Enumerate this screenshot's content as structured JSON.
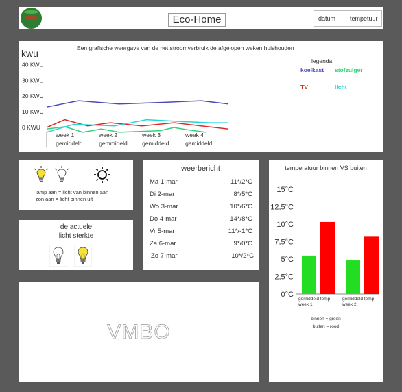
{
  "header": {
    "title": "Eco-Home",
    "date_label": "datum",
    "temp_label": "tempetuur"
  },
  "energy": {
    "unit_label": "kwu",
    "caption": "Een grafische weergave van de het stroomverbruik de  afgelopen weken huishouden",
    "legend_title": "legenda",
    "chart_data": {
      "type": "line",
      "ylabel": "kwu",
      "ytick_labels": [
        "40 KWU",
        "30 KWU",
        "20 KWU",
        "10 KWU",
        "0  KWU"
      ],
      "ytick_values": [
        40,
        30,
        20,
        10,
        0
      ],
      "ylim": [
        0,
        45
      ],
      "xlim": [
        0,
        4
      ],
      "x_labels": [
        {
          "line1": "week 1",
          "line2": "gemiddeld",
          "x": 0.2
        },
        {
          "line1": "week 2",
          "line2": "gemmideld",
          "x": 1.15
        },
        {
          "line1": "week 3",
          "line2": "gemiddeld",
          "x": 2.1
        },
        {
          "line1": "week 4",
          "line2": "gemiddeld",
          "x": 3.05
        }
      ],
      "grid": false,
      "legend_position": "top-right",
      "series": [
        {
          "name": "koelkast",
          "color": "#4a4ab8",
          "x": [
            0,
            0.7,
            1.6,
            2.6,
            3.4,
            4
          ],
          "y": [
            13,
            17,
            15,
            16,
            17,
            15
          ]
        },
        {
          "name": "stofzuiger",
          "color": "#35d17a",
          "x": [
            0,
            0.4,
            0.8,
            1.2,
            1.6,
            2.5,
            2.8,
            3.1,
            3.5
          ],
          "y": [
            -1,
            0.5,
            -3,
            -1,
            -3,
            -2,
            0,
            -1.5,
            -3
          ]
        },
        {
          "name": "TV",
          "color": "#e02828",
          "x": [
            0,
            0.4,
            0.9,
            1.4,
            2.1,
            2.8,
            3.4,
            4
          ],
          "y": [
            0,
            5,
            1,
            3,
            1,
            3,
            1,
            -1
          ]
        },
        {
          "name": "licht",
          "color": "#26d6d6",
          "x": [
            0,
            0.6,
            1.5,
            2.2,
            2.8,
            3.6,
            4
          ],
          "y": [
            -3,
            2,
            1,
            5,
            4,
            3,
            3
          ]
        }
      ]
    }
  },
  "lamps": {
    "text_line1": "lamp aan = licht van binnen aan",
    "text_line2": "zon aan = licht binnen uit"
  },
  "light": {
    "title_line1": "de actuele",
    "title_line2": "licht sterkte"
  },
  "weather": {
    "title": "weerbericht",
    "rows": [
      {
        "day": "Ma 1-mar",
        "temp": "11*/2*C"
      },
      {
        "day": "Di 2-mar",
        "temp": "8*/5*C"
      },
      {
        "day": "Wo 3-mar",
        "temp": "10*/6*C"
      },
      {
        "day": "Do 4-mar",
        "temp": "14*/8*C"
      },
      {
        "day": "Vr 5-mar",
        "temp": "11*/-1*C"
      },
      {
        "day": "Za 6-mar",
        "temp": "9*/0*C"
      },
      {
        "day": "Zo 7-mar",
        "temp": "10*/2*C"
      }
    ]
  },
  "temperature": {
    "title": "temperatuur binnen VS buiten",
    "legend_line1": "binnen = groen",
    "legend_line2": "buiten = rood",
    "chart_data": {
      "type": "bar",
      "title": "temperatuur binnen VS buiten",
      "ytick_labels": [
        "15°C",
        "12,5°C",
        "10°C",
        "7,5°C",
        "5°C",
        "2,5°C",
        "0°C"
      ],
      "ytick_values": [
        15,
        12.5,
        10,
        7.5,
        5,
        2.5,
        0
      ],
      "ylim": [
        0,
        15
      ],
      "categories": [
        {
          "line1": "gemiddeld temp",
          "line2": "week 1"
        },
        {
          "line1": "gemiddeld temp",
          "line2": "week 2"
        }
      ],
      "series": [
        {
          "name": "binnen",
          "color": "#22dd22",
          "values": [
            5.5,
            4.8
          ]
        },
        {
          "name": "buiten",
          "color": "#ff0000",
          "values": [
            10.3,
            8.2
          ]
        }
      ],
      "grid": false
    }
  },
  "footer_logo": "VMBO"
}
